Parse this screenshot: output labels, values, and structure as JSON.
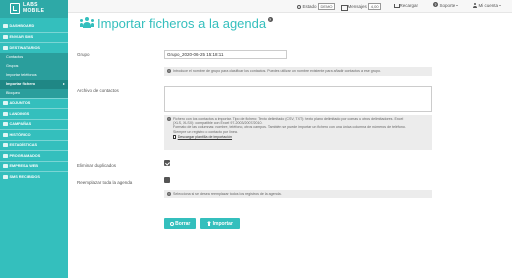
{
  "brand": {
    "logo_text": "LABS MOBILE"
  },
  "topbar": {
    "state_label": "Estado",
    "state_value": "DEMO",
    "messages_label": "Mensajes",
    "messages_value": "4,00",
    "recharge_label": "Recargar",
    "support_label": "Soporte",
    "account_label": "Mi cuenta"
  },
  "sidebar": {
    "items": [
      {
        "label": "DASHBOARD",
        "type": "main",
        "icon": "dashboard-icon"
      },
      {
        "label": "ENVIAR SMS",
        "type": "main",
        "icon": "send-icon"
      },
      {
        "label": "DESTINATARIOS",
        "type": "main",
        "icon": "contacts-icon"
      },
      {
        "label": "Contactos",
        "type": "sub"
      },
      {
        "label": "Grupos",
        "type": "sub"
      },
      {
        "label": "Importar teléfonos",
        "type": "sub"
      },
      {
        "label": "Importar fichero",
        "type": "sub",
        "active": true
      },
      {
        "label": "Bloqueo",
        "type": "sub"
      },
      {
        "label": "ADJUNTOS",
        "type": "main",
        "icon": "attachment-icon"
      },
      {
        "label": "LANDINGS",
        "type": "main",
        "icon": "landing-icon"
      },
      {
        "label": "CAMPAÑAS",
        "type": "main",
        "icon": "campaign-icon"
      },
      {
        "label": "HISTÓRICO",
        "type": "main",
        "icon": "history-icon"
      },
      {
        "label": "ESTADÍSTICAS",
        "type": "main",
        "icon": "stats-icon"
      },
      {
        "label": "PROGRAMADOS",
        "type": "main",
        "icon": "calendar-icon"
      },
      {
        "label": "EMPRESA WEB",
        "type": "main",
        "icon": "web-icon"
      },
      {
        "label": "SMS RECIBIDOS",
        "type": "main",
        "icon": "inbox-icon"
      }
    ]
  },
  "main": {
    "title": "Importar ficheros a la agenda",
    "title_help": "?",
    "group": {
      "label": "Grupo",
      "value": "Grupo_2020-06-25 15:18:11",
      "help": "Introduce el nombre de grupo para clasificar los contactos. Puedes utilizar un nombre existente para añadir contactos a ese grupo."
    },
    "contacts_file": {
      "label": "Archivo de contactos",
      "help_lines": [
        "Fichero con los contactos a importar. Tipo de fichero: Texto delimitado (CSV, TXT): texto plano delimitado por comas u otros delimitadores. Excel",
        "(XLS, XLSX): compatible con Excel 97-2003/2007/2010.",
        "Formato de las columnas: nombre, teléfono, otros campos. También se puede importar un fichero con una única columna de números de teléfono.",
        "Siempre un registro o contacto por línea."
      ],
      "download_link": "Descargar plantilla de importación"
    },
    "remove_duplicates": {
      "label": "Eliminar duplicados",
      "checked": true
    },
    "replace_agenda": {
      "label": "Reemplazar toda la agenda",
      "checked": false,
      "help": "Selecciona si se desea reemplazar todos los registros de la agenda."
    },
    "buttons": {
      "clear": "Borrar",
      "import": "Importar"
    }
  }
}
